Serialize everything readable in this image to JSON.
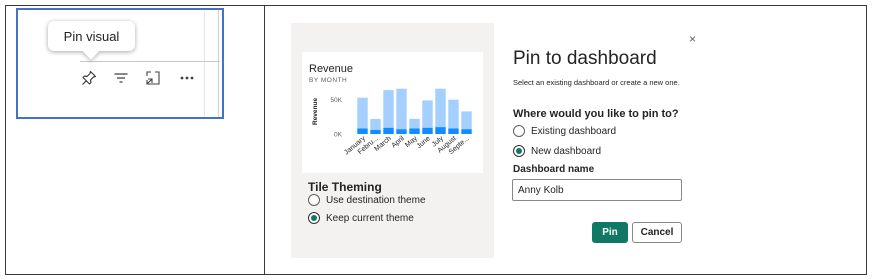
{
  "left_panel": {
    "tooltip": "Pin visual",
    "icons": [
      "pin-icon",
      "filter-icon",
      "focus-mode-icon",
      "more-options-icon"
    ]
  },
  "preview": {
    "tile_title": "Revenue",
    "tile_subtitle": "BY MONTH",
    "theming_title": "Tile Theming",
    "theming_options": [
      {
        "label": "Use destination theme",
        "selected": false
      },
      {
        "label": "Keep current theme",
        "selected": true
      }
    ]
  },
  "chart_data": {
    "type": "bar",
    "title": "Revenue",
    "subtitle": "BY MONTH",
    "ylabel": "Revenue",
    "xlabel": "",
    "y_tick_labels": [
      "50K",
      "0K"
    ],
    "ylim": [
      0,
      70000
    ],
    "categories": [
      "January",
      "Febru...",
      "March",
      "April",
      "May",
      "June",
      "July",
      "August",
      "Septe..."
    ],
    "series": [
      {
        "values": [
          8000,
          6000,
          9000,
          7000,
          8000,
          9000,
          10000,
          8000,
          7000
        ],
        "color": "#118dff"
      },
      {
        "values": [
          45000,
          16000,
          55000,
          59000,
          14000,
          40000,
          56000,
          42000,
          26000
        ],
        "color": "#a4cfff"
      }
    ],
    "colors": {
      "dark": "#118dff",
      "light": "#a4cfff"
    }
  },
  "dialog": {
    "title": "Pin to dashboard",
    "close": "×",
    "description": "Select an existing dashboard or create a new one.",
    "question": "Where would you like to pin to?",
    "options": [
      {
        "label": "Existing dashboard",
        "selected": false
      },
      {
        "label": "New dashboard",
        "selected": true
      }
    ],
    "name_label": "Dashboard name",
    "name_value": "Anny Kolb",
    "pin_label": "Pin",
    "cancel_label": "Cancel",
    "accent": "#117865"
  }
}
